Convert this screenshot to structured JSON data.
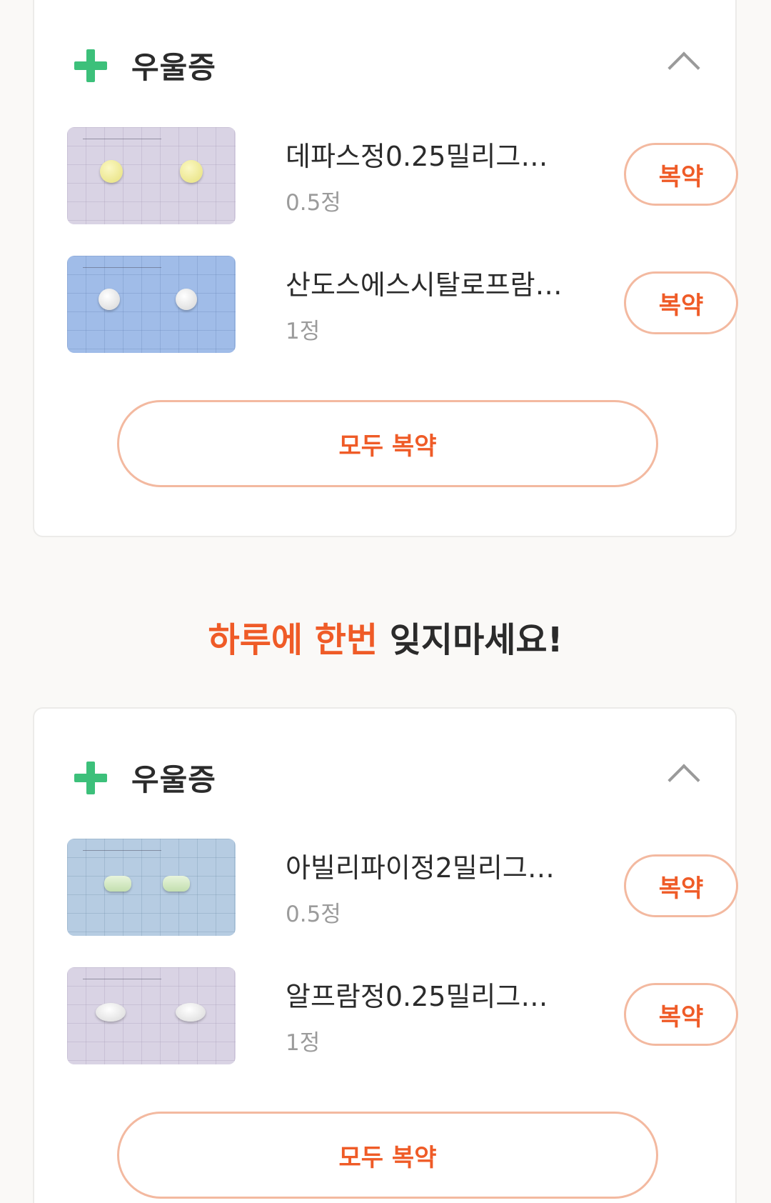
{
  "groups": [
    {
      "category": "우울증",
      "medications": [
        {
          "name": "데파스정0.25밀리그…",
          "dose": "0.5정",
          "take_label": "복약"
        },
        {
          "name": "산도스에스시탈로프람…",
          "dose": "1정",
          "take_label": "복약"
        }
      ],
      "take_all_label": "모두 복약"
    },
    {
      "category": "우울증",
      "medications": [
        {
          "name": "아빌리파이정2밀리그…",
          "dose": "0.5정",
          "take_label": "복약"
        },
        {
          "name": "알프람정0.25밀리그…",
          "dose": "1정",
          "take_label": "복약"
        }
      ],
      "take_all_label": "모두 복약"
    }
  ],
  "reminder": {
    "highlight": "하루에 한번",
    "rest": "잊지마세요!"
  },
  "icons": {
    "category": "plus-icon",
    "collapse": "chevron-up-icon"
  },
  "colors": {
    "accent": "#ef5b27",
    "category_plus": "#3cc07a",
    "button_border": "#f3b9a0",
    "text_primary": "#2b2b2b",
    "text_secondary": "#9b9b9b"
  }
}
